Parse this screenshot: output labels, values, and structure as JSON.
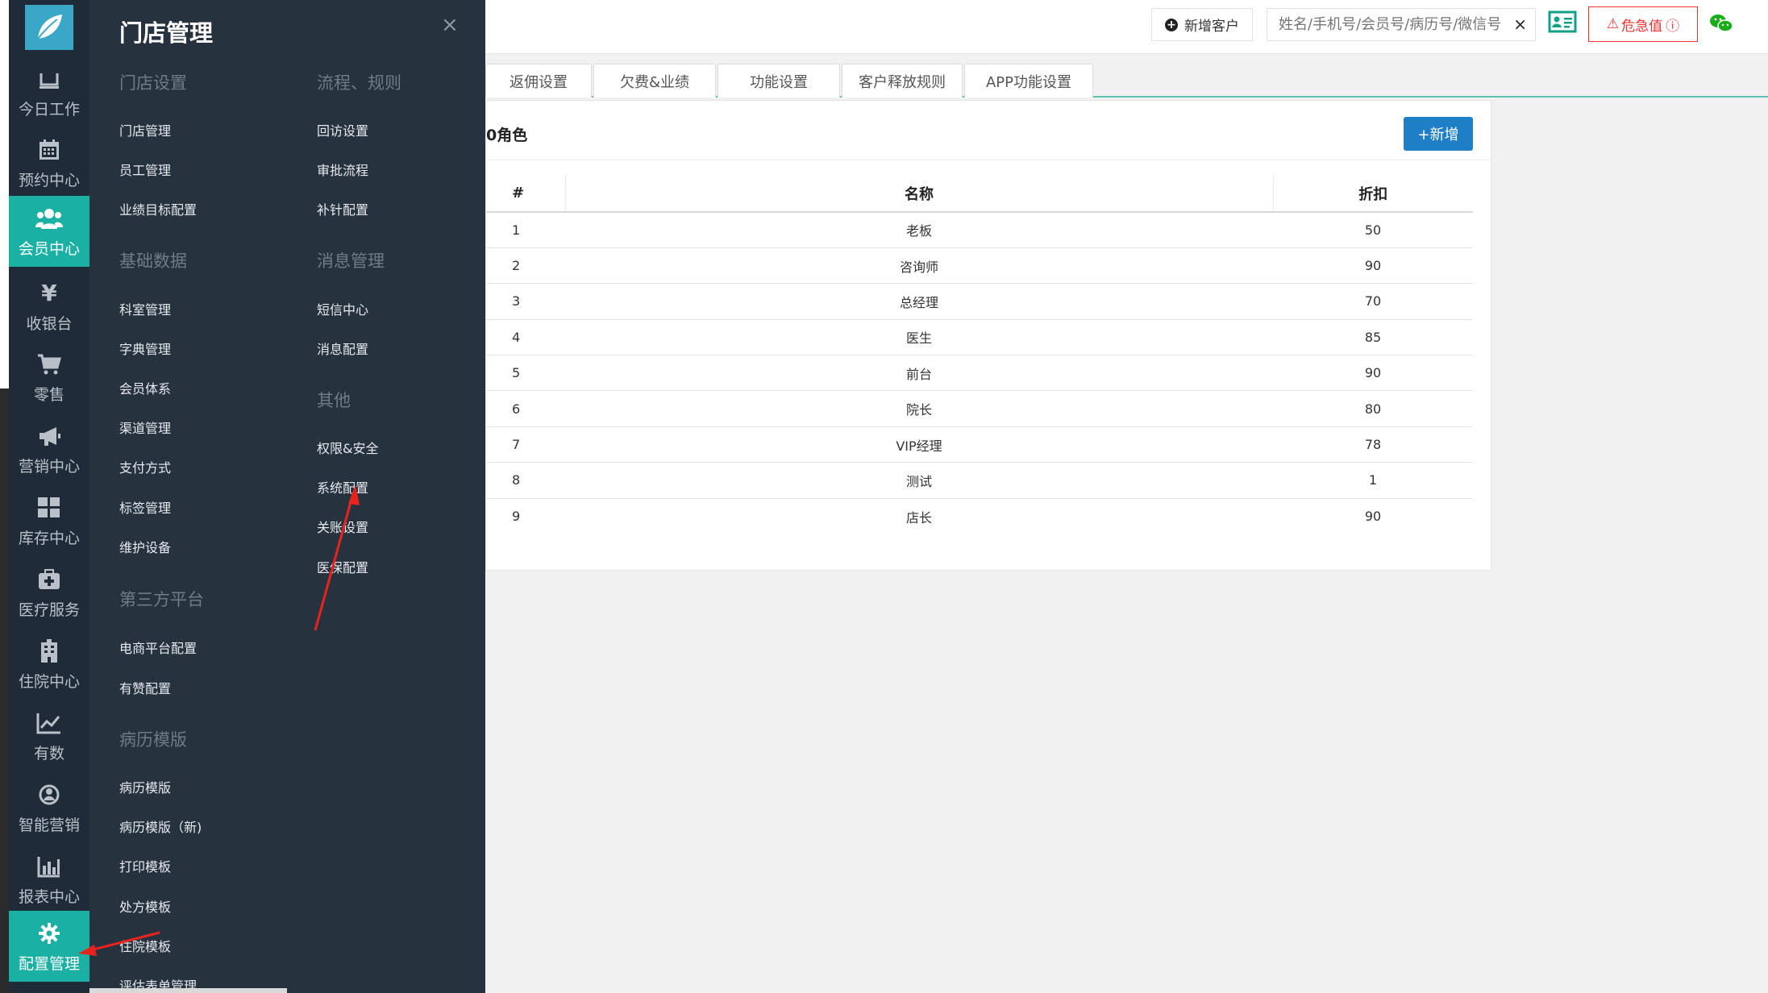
{
  "sidebar": {
    "items": [
      {
        "label": "今日工作",
        "icon": "desk-icon"
      },
      {
        "label": "预约中心",
        "icon": "calendar-icon"
      },
      {
        "label": "会员中心",
        "icon": "users-icon",
        "active": true
      },
      {
        "label": "收银台",
        "icon": "yen-icon"
      },
      {
        "label": "零售",
        "icon": "cart-icon"
      },
      {
        "label": "营销中心",
        "icon": "megaphone-icon"
      },
      {
        "label": "库存中心",
        "icon": "grid-icon"
      },
      {
        "label": "医疗服务",
        "icon": "medkit-icon"
      },
      {
        "label": "住院中心",
        "icon": "building-icon"
      },
      {
        "label": "有数",
        "icon": "line-chart-icon"
      },
      {
        "label": "智能营销",
        "icon": "smart-icon"
      },
      {
        "label": "报表中心",
        "icon": "bar-chart-icon"
      },
      {
        "label": "配置管理",
        "icon": "gear-icon",
        "active": true
      }
    ]
  },
  "flyout": {
    "title": "门店管理",
    "close": "×",
    "sections": {
      "store": {
        "head": "门店设置",
        "links": [
          "门店管理",
          "员工管理",
          "业绩目标配置"
        ]
      },
      "basic": {
        "head": "基础数据",
        "links": [
          "科室管理",
          "字典管理",
          "会员体系",
          "渠道管理",
          "支付方式",
          "标签管理",
          "维护设备"
        ]
      },
      "third": {
        "head": "第三方平台",
        "links": [
          "电商平台配置",
          "有赞配置"
        ]
      },
      "records": {
        "head": "病历模版",
        "links": [
          "病历模版",
          "病历模版（新)",
          "打印模板",
          "处方模板",
          "住院模板",
          "评估表单管理"
        ]
      },
      "flow": {
        "head": "流程、规则",
        "links": [
          "回访设置",
          "审批流程",
          "补针配置"
        ]
      },
      "msg": {
        "head": "消息管理",
        "links": [
          "短信中心",
          "消息配置"
        ]
      },
      "other": {
        "head": "其他",
        "links": [
          "权限&安全",
          "系统配置",
          "关账设置",
          "医保配置"
        ]
      }
    }
  },
  "topbar": {
    "new_customer": "新增客户",
    "search_placeholder": "姓名/手机号/会员号/病历号/微信号",
    "clear": "×",
    "danger_label": "危急值",
    "danger_icon": "ⓘ"
  },
  "tabs": [
    "返佣设置",
    "欠费&业绩",
    "功能设置",
    "客户释放规则",
    "APP功能设置"
  ],
  "panel": {
    "title": "0角色",
    "add_button": "+新增",
    "columns": [
      "#",
      "名称",
      "折扣"
    ],
    "rows": [
      {
        "idx": "1",
        "name": "老板",
        "discount": "50"
      },
      {
        "idx": "2",
        "name": "咨询师",
        "discount": "90"
      },
      {
        "idx": "3",
        "name": "总经理",
        "discount": "70"
      },
      {
        "idx": "4",
        "name": "医生",
        "discount": "85"
      },
      {
        "idx": "5",
        "name": "前台",
        "discount": "90"
      },
      {
        "idx": "6",
        "name": "院长",
        "discount": "80"
      },
      {
        "idx": "7",
        "name": "VIP经理",
        "discount": "78"
      },
      {
        "idx": "8",
        "name": "测试",
        "discount": "1"
      },
      {
        "idx": "9",
        "name": "店长",
        "discount": "90"
      }
    ]
  },
  "colors": {
    "nav_bg": "#1f2b38",
    "flyout_bg": "#27323f",
    "active": "#1bb0a4",
    "primary": "#1e7fc6",
    "danger": "#e33333",
    "tab_line": "#5cc2ac"
  }
}
